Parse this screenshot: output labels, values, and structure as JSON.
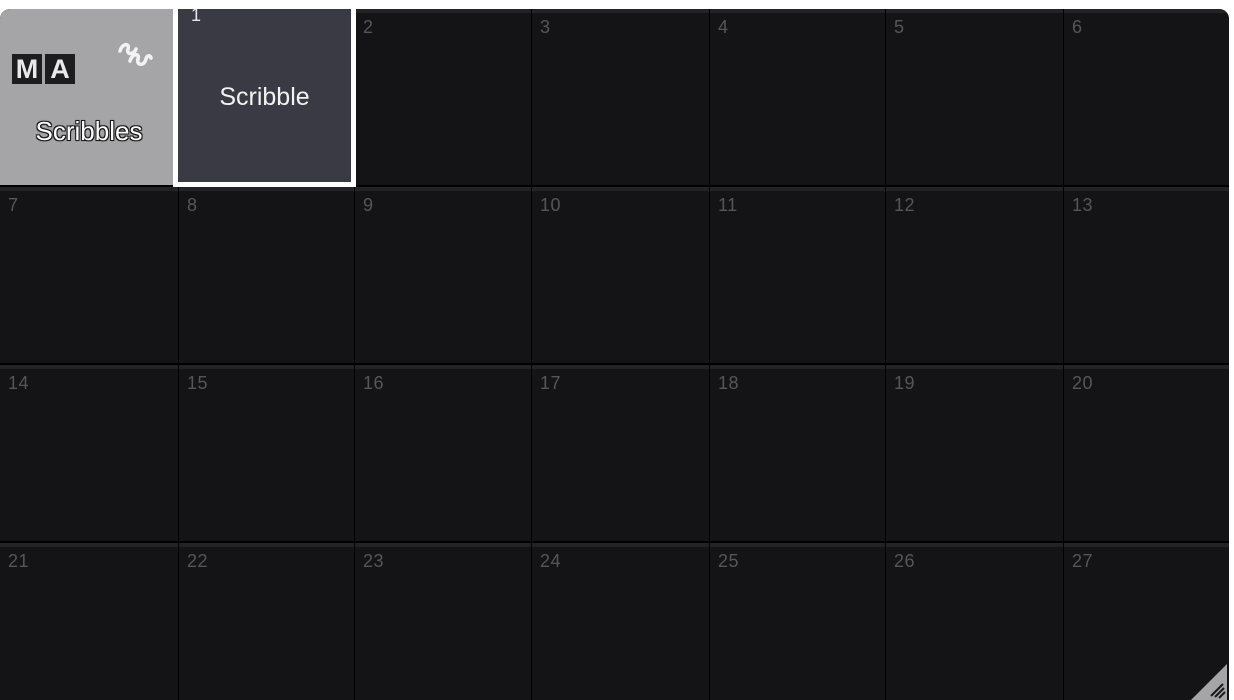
{
  "title_panel": {
    "logo_letters": [
      "M",
      "A"
    ],
    "icon": "scribble-icon",
    "label": "Scribbles"
  },
  "cells": [
    {
      "number": "1",
      "label": "Scribble",
      "selected": true
    },
    {
      "number": "2",
      "label": ""
    },
    {
      "number": "3",
      "label": ""
    },
    {
      "number": "4",
      "label": ""
    },
    {
      "number": "5",
      "label": ""
    },
    {
      "number": "6",
      "label": ""
    },
    {
      "number": "7",
      "label": ""
    },
    {
      "number": "8",
      "label": ""
    },
    {
      "number": "9",
      "label": ""
    },
    {
      "number": "10",
      "label": ""
    },
    {
      "number": "11",
      "label": ""
    },
    {
      "number": "12",
      "label": ""
    },
    {
      "number": "13",
      "label": ""
    },
    {
      "number": "14",
      "label": ""
    },
    {
      "number": "15",
      "label": ""
    },
    {
      "number": "16",
      "label": ""
    },
    {
      "number": "17",
      "label": ""
    },
    {
      "number": "18",
      "label": ""
    },
    {
      "number": "19",
      "label": ""
    },
    {
      "number": "20",
      "label": ""
    },
    {
      "number": "21",
      "label": ""
    },
    {
      "number": "22",
      "label": ""
    },
    {
      "number": "23",
      "label": ""
    },
    {
      "number": "24",
      "label": ""
    },
    {
      "number": "25",
      "label": ""
    },
    {
      "number": "26",
      "label": ""
    },
    {
      "number": "27",
      "label": ""
    }
  ],
  "colors": {
    "title_bg": "#a5a5a7",
    "cell_bg": "#141416",
    "selected_cell_bg": "#3a3a44",
    "selected_border": "#ffffff",
    "grid_line": "#000000",
    "cell_number": "#55565b"
  },
  "resize_grip_icon": "resize-grip-icon"
}
